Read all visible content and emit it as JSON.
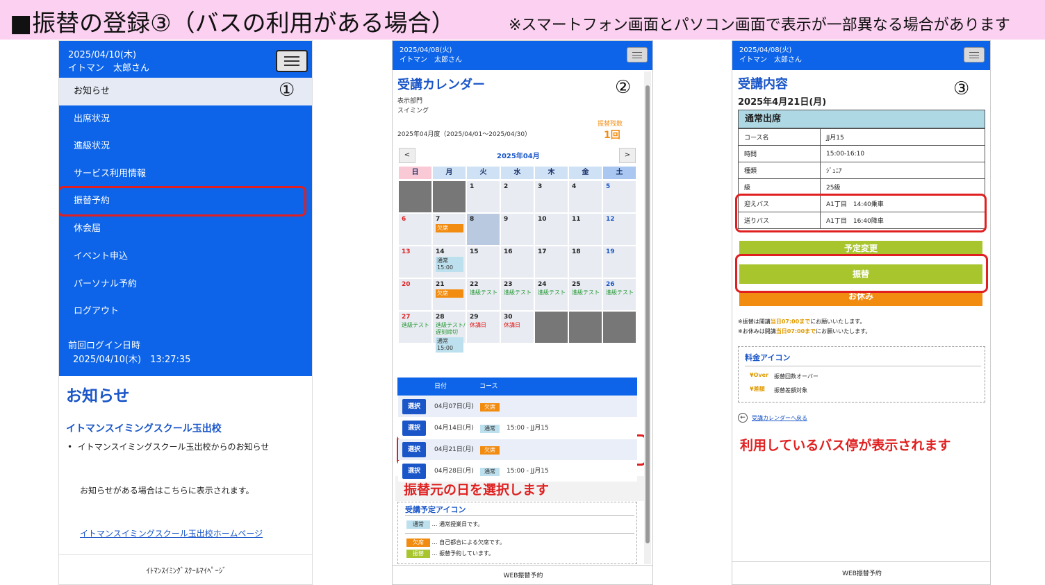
{
  "title": {
    "main": "■振替の登録③（バスの利用がある場合）",
    "note": "※スマートフォン画面とパソコン画面で表示が一部異なる場合があります"
  },
  "panel1": {
    "date": "2025/04/10(木)",
    "user": "イトマン　太郎さん",
    "circle_number": "①",
    "menu": [
      "お知らせ",
      "出席状況",
      "進級状況",
      "サービス利用情報",
      "振替予約",
      "休会届",
      "イベント申込",
      "パーソナル予約",
      "ログアウト"
    ],
    "last_login_label": "前回ログイン日時",
    "last_login_value": "2025/04/10(木)　13:27:35",
    "notice_heading": "お知らせ",
    "school_heading": "イトマンスイミングスクール玉出校",
    "bullet": "イトマンスイミングスクール玉出校からのお知らせ",
    "notice_text": "お知らせがある場合はこちらに表示されます。",
    "homepage_link": "イトマンスイミングスクール玉出校ホームページ",
    "footer": "ｲﾄﾏﾝｽｲﾐﾝｸﾞｽｸｰﾙﾏｲﾍﾟｰｼﾞ"
  },
  "panel2": {
    "date": "2025/04/08(火)",
    "user": "イトマン　太郎さん",
    "circle_number": "②",
    "heading": "受講カレンダー",
    "dept_label": "表示部門",
    "dept_value": "スイミング",
    "period": "2025年04月度（2025/04/01～2025/04/30）",
    "remaining_label": "振替残数",
    "remaining_value": "1回",
    "prev": "<",
    "next": ">",
    "month": "2025年04月",
    "weekdays": [
      "日",
      "月",
      "火",
      "水",
      "木",
      "金",
      "土"
    ],
    "weekday_colors": [
      "#f9c9d6",
      "#cfe2f5",
      "#cfe2f5",
      "#cfe2f5",
      "#cfe2f5",
      "#cfe2f5",
      "#a9c7f0"
    ],
    "weeks": [
      [
        {
          "d": "",
          "gray": true
        },
        {
          "d": "",
          "gray": true
        },
        {
          "d": "1"
        },
        {
          "d": "2"
        },
        {
          "d": "3"
        },
        {
          "d": "4"
        },
        {
          "d": "5",
          "c": "#1a56c8"
        }
      ],
      [
        {
          "d": "6",
          "c": "#e02020"
        },
        {
          "d": "7",
          "tags": [
            {
              "t": "欠席",
              "k": "o"
            }
          ]
        },
        {
          "d": "8",
          "sel": true
        },
        {
          "d": "9"
        },
        {
          "d": "10"
        },
        {
          "d": "11"
        },
        {
          "d": "12",
          "c": "#1a56c8"
        }
      ],
      [
        {
          "d": "13",
          "c": "#e02020"
        },
        {
          "d": "14",
          "tags": [
            {
              "t": "通常 15:00",
              "k": "b"
            }
          ]
        },
        {
          "d": "15"
        },
        {
          "d": "16"
        },
        {
          "d": "17"
        },
        {
          "d": "18"
        },
        {
          "d": "19",
          "c": "#1a56c8"
        }
      ],
      [
        {
          "d": "20",
          "c": "#e02020"
        },
        {
          "d": "21",
          "tags": [
            {
              "t": "欠席",
              "k": "o"
            }
          ]
        },
        {
          "d": "22",
          "tags": [
            {
              "t": "進級テスト",
              "k": "g"
            }
          ]
        },
        {
          "d": "23",
          "tags": [
            {
              "t": "進級テスト",
              "k": "g"
            }
          ]
        },
        {
          "d": "24",
          "tags": [
            {
              "t": "進級テスト",
              "k": "g"
            }
          ]
        },
        {
          "d": "25",
          "tags": [
            {
              "t": "進級テスト",
              "k": "g"
            }
          ]
        },
        {
          "d": "26",
          "c": "#1a56c8",
          "tags": [
            {
              "t": "進級テスト",
              "k": "g"
            }
          ]
        }
      ],
      [
        {
          "d": "27",
          "c": "#e02020",
          "tags": [
            {
              "t": "進級テスト",
              "k": "g"
            }
          ]
        },
        {
          "d": "28",
          "tags": [
            {
              "t": "進級テスト/遅刻締切",
              "k": "g"
            },
            {
              "t": "通常 15:00",
              "k": "b"
            }
          ]
        },
        {
          "d": "29",
          "tags": [
            {
              "t": "休講日",
              "k": "r"
            }
          ]
        },
        {
          "d": "30",
          "tags": [
            {
              "t": "休講日",
              "k": "r"
            }
          ]
        },
        {
          "d": "",
          "gray": true
        },
        {
          "d": "",
          "gray": true
        },
        {
          "d": "",
          "gray": true
        }
      ]
    ],
    "list_header": {
      "date": "日付",
      "course": "コース"
    },
    "list_rows": [
      {
        "btn": "選択",
        "date": "04月07日(月)",
        "tag": "欠席",
        "tagk": "o",
        "course": ""
      },
      {
        "btn": "選択",
        "date": "04月14日(月)",
        "tag": "通常",
        "tagk": "b",
        "course": "15:00 - JJ月15"
      },
      {
        "btn": "選択",
        "date": "04月21日(月)",
        "tag": "欠席",
        "tagk": "o",
        "course": ""
      },
      {
        "btn": "選択",
        "date": "04月28日(月)",
        "tag": "通常",
        "tagk": "b",
        "course": "15:00 - JJ月15"
      }
    ],
    "caption": "振替元の日を選択します",
    "icon_legend_heading": "受講予定アイコン",
    "legend": [
      {
        "tag": "通常",
        "tagk": "b",
        "desc": "… 通常授業日です。"
      },
      {
        "tag": "欠席",
        "tagk": "o",
        "desc": "… 自己都合による欠席です。"
      },
      {
        "tag": "振替",
        "tagk": "g2",
        "desc": "… 振替予約しています。"
      }
    ],
    "footer": "WEB振替予約"
  },
  "panel3": {
    "date": "2025/04/08(火)",
    "user": "イトマン　太郎さん",
    "circle_number": "③",
    "heading": "受講内容",
    "lesson_date": "2025年4月21日(月)",
    "table_header": "通常出席",
    "rows": [
      {
        "k": "コース名",
        "v": "JJ月15"
      },
      {
        "k": "時間",
        "v": "15:00-16:10"
      },
      {
        "k": "種類",
        "v": "ｼﾞｭﾆｱ"
      },
      {
        "k": "級",
        "v": "25級"
      },
      {
        "k": "迎えバス",
        "v": "A1丁目　14:40乗車"
      },
      {
        "k": "送りバス",
        "v": "A1丁目　16:40降車"
      }
    ],
    "btn_change": "予定変更",
    "btn_transfer": "振替",
    "btn_rest": "お休み",
    "note1_a": "※振替は開講",
    "note1_b": "当日07:00まで",
    "note1_c": "にお願いいたします。",
    "note2_a": "※お休みは開講",
    "note2_b": "当日07:00まで",
    "note2_c": "にお願いいたします。",
    "fee_heading": "料金アイコン",
    "fee1_icon": "Over",
    "fee1": "振替回数オーバー",
    "fee2_icon": "差額",
    "fee2": "振替差額対象",
    "back_link": "受講カレンダーへ戻る",
    "caption": "利用しているバス停が表示されます",
    "footer": "WEB振替予約"
  }
}
